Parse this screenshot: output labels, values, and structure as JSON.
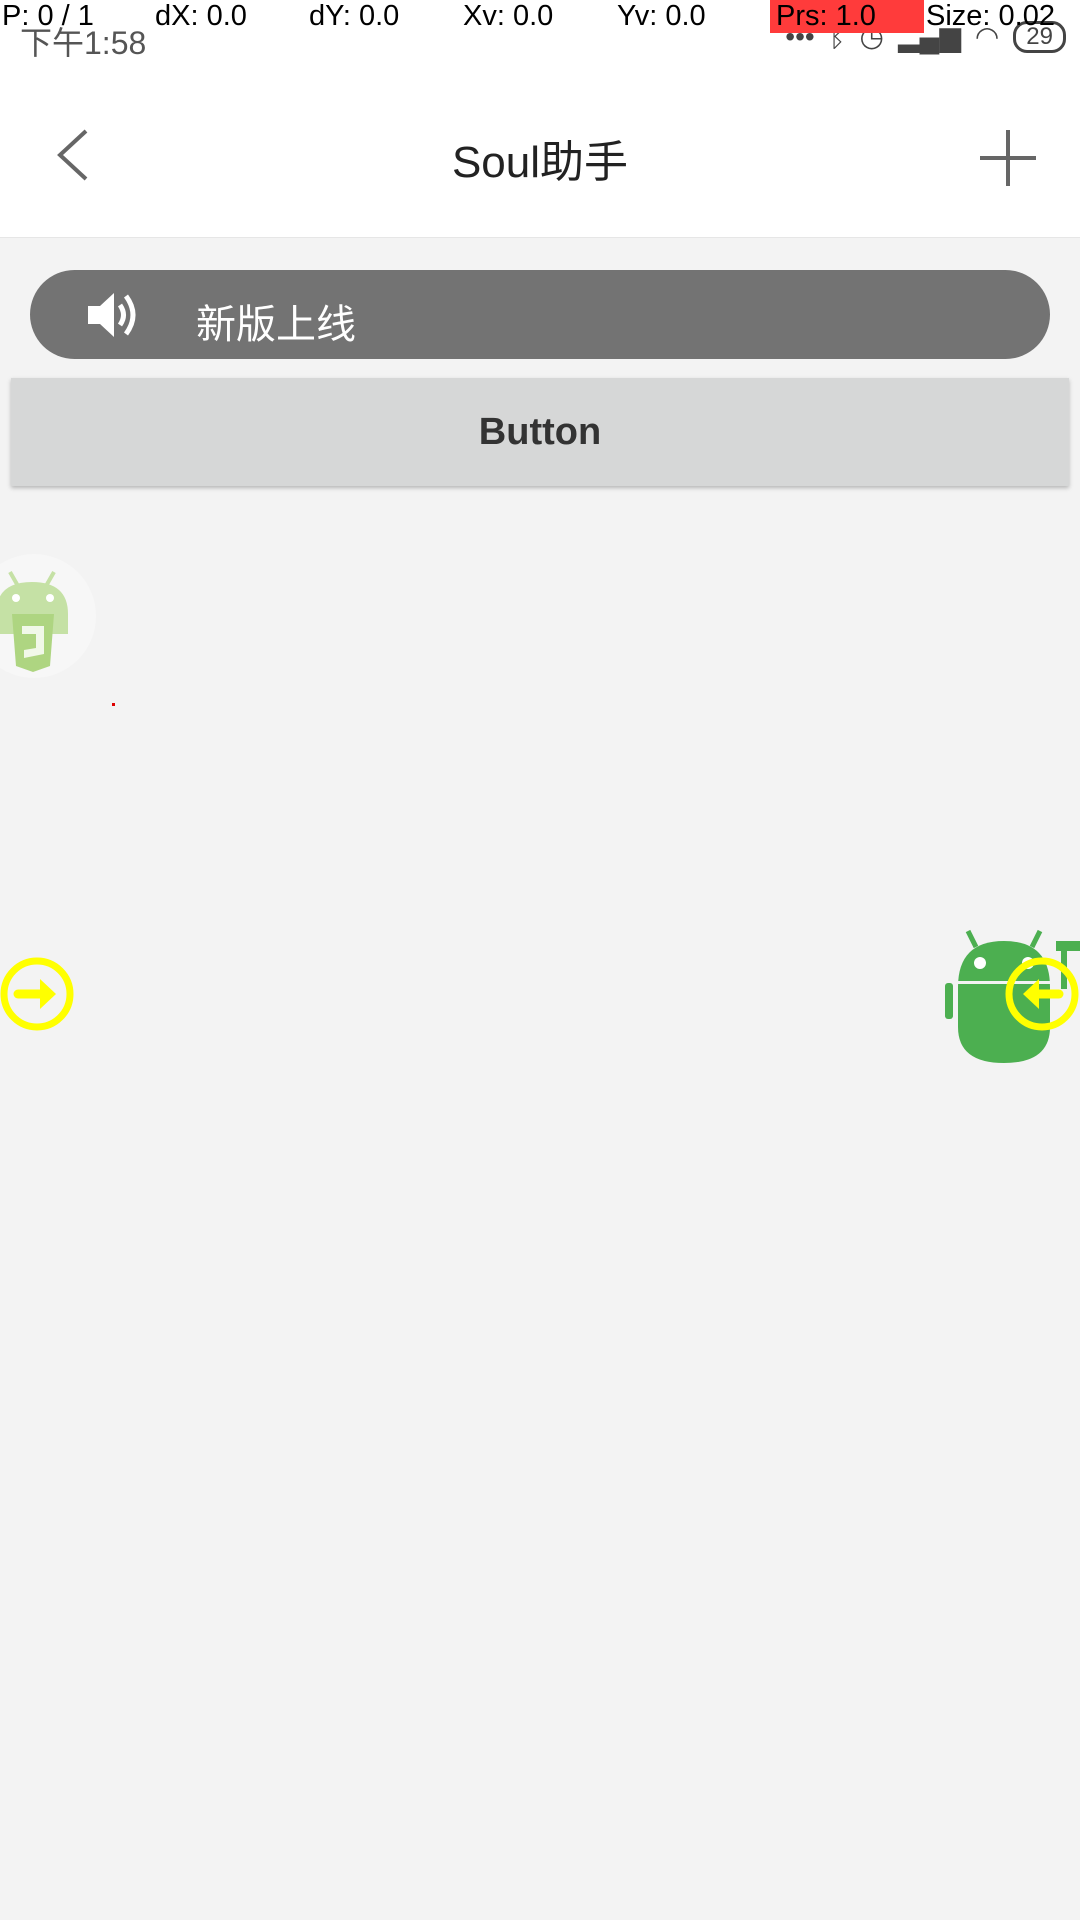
{
  "status_bar": {
    "time": "下午1:58",
    "battery": "29",
    "icons": [
      "more-dots-icon",
      "bluetooth-icon",
      "alarm-icon",
      "signal-icon",
      "wifi-icon",
      "battery-icon"
    ]
  },
  "pointer_overlay": {
    "p": "P: 0 / 1",
    "dx": "dX: 0.0",
    "dy": "dY: 0.0",
    "xv": "Xv: 0.0",
    "yv": "Yv: 0.0",
    "prs": "Prs: 1.0",
    "size": "Size: 0.02"
  },
  "header": {
    "title": "Soul助手",
    "back_icon": "chevron-left-icon",
    "add_icon": "plus-icon"
  },
  "notice": {
    "text": "新版上线",
    "icon": "speaker-icon"
  },
  "button": {
    "label": "Button"
  },
  "floating": {
    "colors": {
      "yellow": "#ffff00",
      "green": "#4caf50",
      "notice_bg": "#737373"
    }
  }
}
